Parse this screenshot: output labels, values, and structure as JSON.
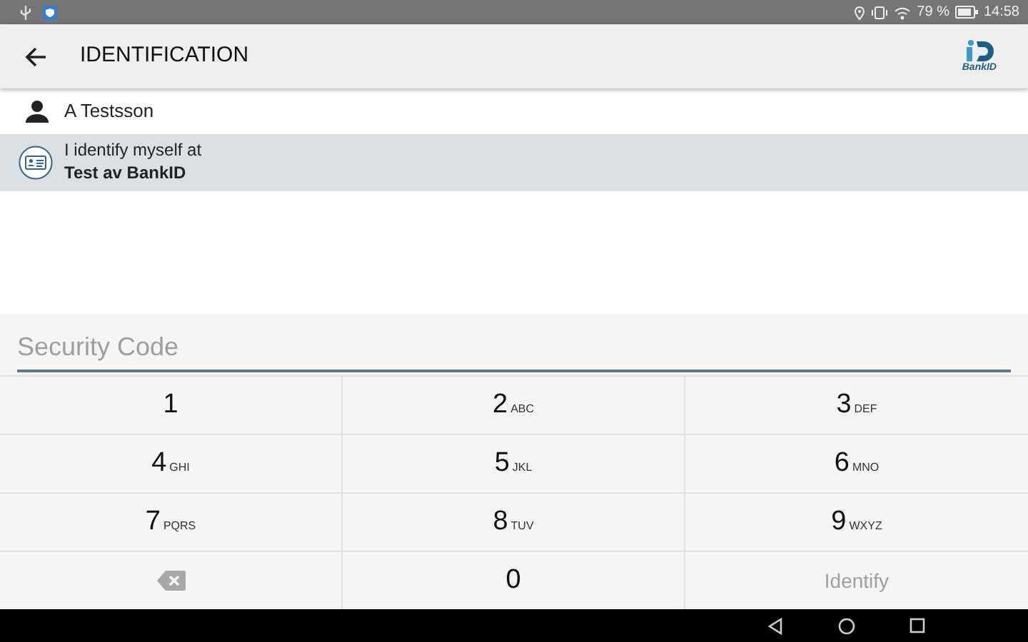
{
  "status_bar": {
    "battery": "79 %",
    "time": "14:58"
  },
  "app_bar": {
    "title": "IDENTIFICATION",
    "logo_text": "BankID"
  },
  "user": {
    "name": "A Testsson"
  },
  "identify_row": {
    "line_1": "I identify myself at",
    "line_2": "Test av BankID"
  },
  "security_code": {
    "placeholder": "Security Code"
  },
  "keypad": [
    {
      "kind": "digit",
      "digit": "1"
    },
    {
      "kind": "digit",
      "digit": "2",
      "letters": "ABC"
    },
    {
      "kind": "digit",
      "digit": "3",
      "letters": "DEF"
    },
    {
      "kind": "digit",
      "digit": "4",
      "letters": "GHI"
    },
    {
      "kind": "digit",
      "digit": "5",
      "letters": "JKL"
    },
    {
      "kind": "digit",
      "digit": "6",
      "letters": "MNO"
    },
    {
      "kind": "digit",
      "digit": "7",
      "letters": "PQRS"
    },
    {
      "kind": "digit",
      "digit": "8",
      "letters": "TUV"
    },
    {
      "kind": "digit",
      "digit": "9",
      "letters": "WXYZ"
    },
    {
      "kind": "backspace"
    },
    {
      "kind": "digit",
      "digit": "0"
    },
    {
      "kind": "action",
      "label": "Identify",
      "disabled": true
    }
  ]
}
